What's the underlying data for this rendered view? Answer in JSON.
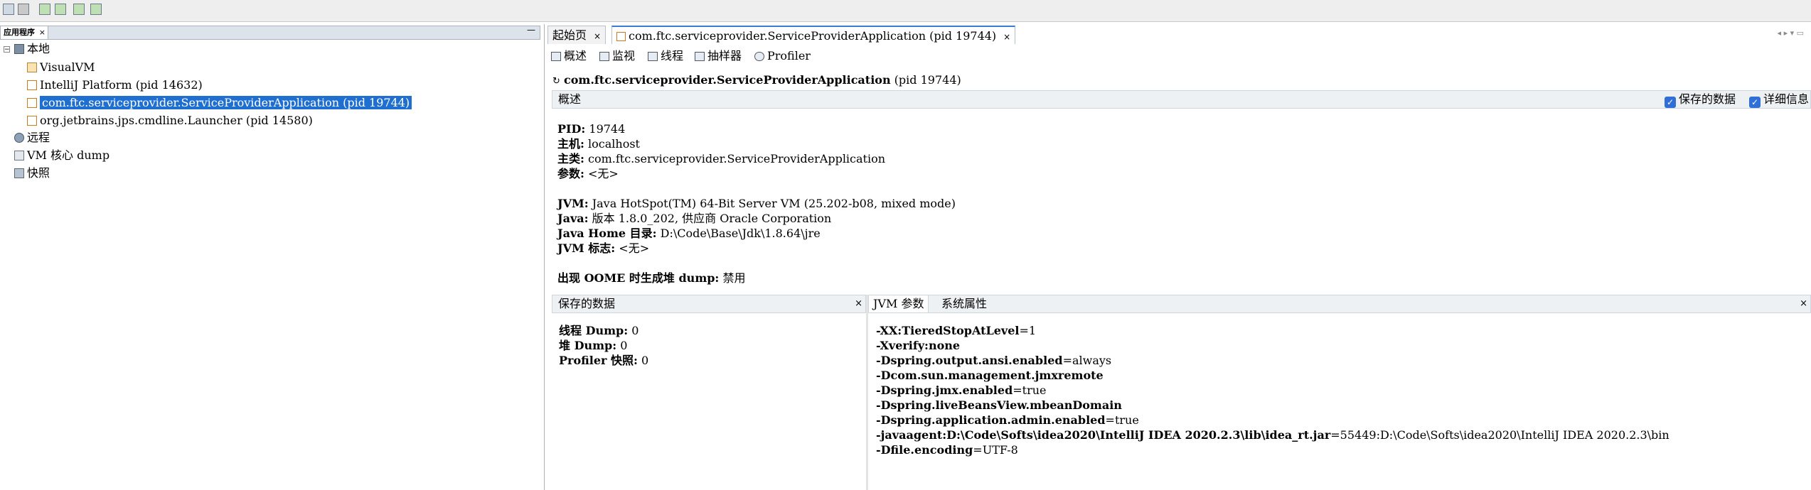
{
  "toolbar": {
    "icons": [
      "open-app-icon",
      "open-dump-icon",
      "heap-dump-icon",
      "thread-dump-icon",
      "snapshot-icon",
      "compare-icon"
    ]
  },
  "left_panel": {
    "tab_label": "应用程序",
    "tab_close": "×",
    "minimize": "—",
    "tree": {
      "local": "本地",
      "visualvm": "VisualVM",
      "intellij": "IntelliJ Platform (pid 14632)",
      "service_app": "com.ftc.serviceprovider.ServiceProviderApplication (pid 19744)",
      "launcher": "org.jetbrains.jps.cmdline.Launcher (pid 14580)",
      "remote": "远程",
      "core_dump": "VM 核心 dump",
      "snapshot": "快照"
    }
  },
  "doc_tabs": {
    "start_page": "起始页",
    "app_tab": "com.ftc.serviceprovider.ServiceProviderApplication (pid 19744)",
    "close": "×"
  },
  "view_tabs": {
    "overview": "概述",
    "monitor": "监视",
    "threads": "线程",
    "sampler": "抽样器",
    "profiler": "Profiler"
  },
  "app_title": {
    "name": "com.ftc.serviceprovider.ServiceProviderApplication",
    "pid": "(pid 19744)"
  },
  "overview": {
    "section_title": "概述",
    "saved_data_checkbox": "保存的数据",
    "details_checkbox": "详细信息",
    "pid_label": "PID:",
    "pid_value": "19744",
    "host_label": "主机:",
    "host_value": "localhost",
    "main_class_label": "主类:",
    "main_class_value": "com.ftc.serviceprovider.ServiceProviderApplication",
    "args_label": "参数:",
    "args_value": "<无>",
    "jvm_label": "JVM:",
    "jvm_value": "Java HotSpot(TM) 64-Bit Server VM (25.202-b08, mixed mode)",
    "java_label": "Java:",
    "java_value": "版本 1.8.0_202, 供应商 Oracle Corporation",
    "java_home_label": "Java Home 目录:",
    "java_home_value": "D:\\Code\\Base\\Jdk\\1.8.64\\jre",
    "jvm_flags_label": "JVM 标志:",
    "jvm_flags_value": "<无>",
    "oome_label": "出现 OOME 时生成堆 dump:",
    "oome_value": "禁用"
  },
  "saved_data": {
    "title": "保存的数据",
    "close": "×",
    "thread_dump_label": "线程 Dump:",
    "thread_dump_value": "0",
    "heap_dump_label": "堆 Dump:",
    "heap_dump_value": "0",
    "profiler_snapshot_label": "Profiler 快照:",
    "profiler_snapshot_value": "0"
  },
  "jvm_panel": {
    "tab_jvm_args": "JVM 参数",
    "tab_sys_props": "系统属性",
    "close": "×",
    "args": [
      {
        "key": "-XX:TieredStopAtLevel",
        "value": "=1"
      },
      {
        "key": "-Xverify:none",
        "value": ""
      },
      {
        "key": "-Dspring.output.ansi.enabled",
        "value": "=always"
      },
      {
        "key": "-Dcom.sun.management.jmxremote",
        "value": ""
      },
      {
        "key": "-Dspring.jmx.enabled",
        "value": "=true"
      },
      {
        "key": "-Dspring.liveBeansView.mbeanDomain",
        "value": ""
      },
      {
        "key": "-Dspring.application.admin.enabled",
        "value": "=true"
      },
      {
        "key": "-javaagent:D:\\Code\\Softs\\idea2020\\IntelliJ  IDEA  2020.2.3\\lib\\idea_rt.jar",
        "value": "=55449:D:\\Code\\Softs\\idea2020\\IntelliJ  IDEA  2020.2.3\\bin"
      },
      {
        "key": "-Dfile.encoding",
        "value": "=UTF-8"
      }
    ]
  },
  "colors": {
    "selection": "#1f6fd1",
    "checkbox": "#2f6fd6",
    "header_bg": "#eef1f4"
  }
}
